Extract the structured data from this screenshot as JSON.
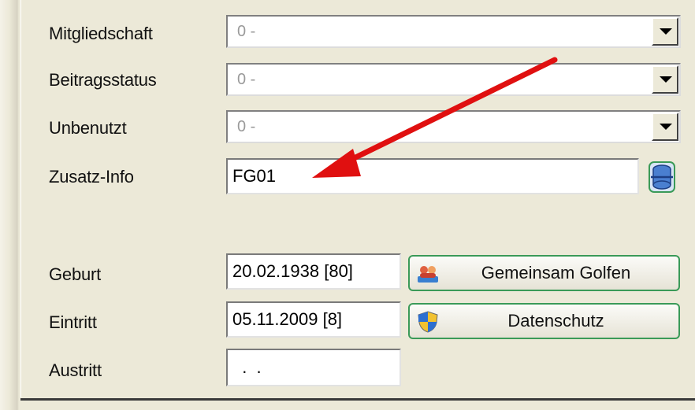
{
  "fields": {
    "mitgliedschaft": {
      "label": "Mitgliedschaft",
      "value": "0 -"
    },
    "beitragsstatus": {
      "label": "Beitragsstatus",
      "value": "0 -"
    },
    "unbenutzt": {
      "label": "Unbenutzt",
      "value": "0 -"
    },
    "zusatz_info": {
      "label": "Zusatz-Info",
      "value": "FG01"
    },
    "geburt": {
      "label": "Geburt",
      "value": "20.02.1938  [80]"
    },
    "eintritt": {
      "label": "Eintritt",
      "value": "05.11.2009  [8]"
    },
    "austritt": {
      "label": "Austritt",
      "value": "  .  ."
    }
  },
  "buttons": {
    "gemeinsam_golfen": "Gemeinsam Golfen",
    "datenschutz": "Datenschutz"
  },
  "icons": {
    "zusatz_side": "database-icon",
    "golf": "golf-people-icon",
    "privacy": "shield-icon"
  },
  "colors": {
    "annotation_arrow": "#e01010",
    "button_border": "#3a9a58"
  }
}
